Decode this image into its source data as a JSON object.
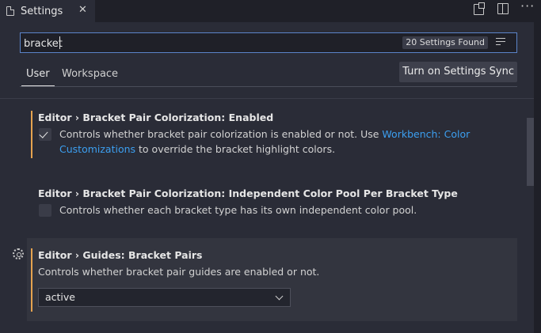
{
  "tab": {
    "title": "Settings",
    "close": "✕"
  },
  "search": {
    "value": "bracket",
    "results_badge": "20 Settings Found"
  },
  "scope_tabs": {
    "user": "User",
    "workspace": "Workspace"
  },
  "sync_button": "Turn on Settings Sync",
  "settings": [
    {
      "title": "Editor › Bracket Pair Colorization: Enabled",
      "desc_before": "Controls whether bracket pair colorization is enabled or not. Use ",
      "desc_link": "Workbench: Color Customizations",
      "desc_after": " to override the bracket highlight colors.",
      "checked": true
    },
    {
      "title": "Editor › Bracket Pair Colorization: Independent Color Pool Per Bracket Type",
      "desc": "Controls whether each bracket type has its own independent color pool.",
      "checked": false
    },
    {
      "title": "Editor › Guides: Bracket Pairs",
      "desc": "Controls whether bracket pair guides are enabled or not.",
      "select_value": "active"
    }
  ],
  "colors": {
    "accent_modified": "#e5a34f",
    "link": "#3c9ff0",
    "focus_border": "#5b84c9"
  }
}
